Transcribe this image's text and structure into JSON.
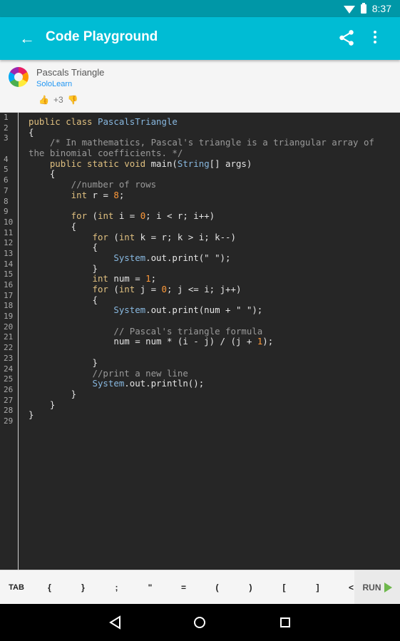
{
  "status": {
    "time": "8:37"
  },
  "app_bar": {
    "title": "Code Playground"
  },
  "code_info": {
    "title": "Pascals Triangle",
    "author": "SoloLearn",
    "votes": "+3"
  },
  "line_numbers": [
    "1",
    "2",
    "3",
    "",
    "4",
    "5",
    "6",
    "7",
    "8",
    "9",
    "10",
    "11",
    "12",
    "13",
    "14",
    "15",
    "16",
    "17",
    "18",
    "19",
    "20",
    "21",
    "22",
    "23",
    "24",
    "25",
    "26",
    "27",
    "28",
    "29"
  ],
  "code_lines": [
    [
      [
        "kw",
        "public class "
      ],
      [
        "ty",
        "PascalsTriangle"
      ]
    ],
    [
      [
        "",
        "{"
      ]
    ],
    [
      [
        "cm",
        "    /* In mathematics, Pascal's triangle is a triangular array of"
      ]
    ],
    [
      [
        "cm",
        "the binomial coefficients. */"
      ]
    ],
    [
      [
        "kw",
        "    public static void "
      ],
      [
        "",
        "main("
      ],
      [
        "ty",
        "String"
      ],
      [
        "",
        "[] args)"
      ]
    ],
    [
      [
        "",
        "    {"
      ]
    ],
    [
      [
        "cm",
        "        //number of rows"
      ]
    ],
    [
      [
        "kw",
        "        int "
      ],
      [
        "",
        "r = "
      ],
      [
        "num",
        "8"
      ],
      [
        "",
        ";"
      ]
    ],
    [
      [
        "",
        ""
      ]
    ],
    [
      [
        "kw",
        "        for "
      ],
      [
        "",
        "("
      ],
      [
        "kw",
        "int "
      ],
      [
        "",
        "i = "
      ],
      [
        "num",
        "0"
      ],
      [
        "",
        "; i < r; i++)"
      ]
    ],
    [
      [
        "",
        "        {"
      ]
    ],
    [
      [
        "kw",
        "            for "
      ],
      [
        "",
        "("
      ],
      [
        "kw",
        "int "
      ],
      [
        "",
        "k = r; k > i; k--)"
      ]
    ],
    [
      [
        "",
        "            {"
      ]
    ],
    [
      [
        "ty",
        "                System"
      ],
      [
        "",
        ".out.print(\" \");"
      ]
    ],
    [
      [
        "",
        "            }"
      ]
    ],
    [
      [
        "kw",
        "            int "
      ],
      [
        "",
        "num = "
      ],
      [
        "num",
        "1"
      ],
      [
        "",
        ";"
      ]
    ],
    [
      [
        "kw",
        "            for "
      ],
      [
        "",
        "("
      ],
      [
        "kw",
        "int "
      ],
      [
        "",
        "j = "
      ],
      [
        "num",
        "0"
      ],
      [
        "",
        "; j <= i; j++)"
      ]
    ],
    [
      [
        "",
        "            {"
      ]
    ],
    [
      [
        "ty",
        "                System"
      ],
      [
        "",
        ".out.print(num + \" \");"
      ]
    ],
    [
      [
        "",
        ""
      ]
    ],
    [
      [
        "cm",
        "                // Pascal's triangle formula"
      ]
    ],
    [
      [
        "",
        "                num = num * (i - j) / (j + "
      ],
      [
        "num",
        "1"
      ],
      [
        "",
        ");"
      ]
    ],
    [
      [
        "",
        ""
      ]
    ],
    [
      [
        "",
        "            }"
      ]
    ],
    [
      [
        "cm",
        "            //print a new line"
      ]
    ],
    [
      [
        "ty",
        "            System"
      ],
      [
        "",
        ".out.println();"
      ]
    ],
    [
      [
        "",
        "        }"
      ]
    ],
    [
      [
        "",
        "    }"
      ]
    ],
    [
      [
        "",
        "}"
      ]
    ],
    [
      [
        "",
        ""
      ]
    ]
  ],
  "keys": [
    "TAB",
    "{",
    "}",
    ";",
    "\"",
    "=",
    "(",
    ")",
    "[",
    "]",
    "<"
  ],
  "run_label": "RUN",
  "colors": {
    "accent": "#00bcd4",
    "status": "#0097a7",
    "editor_bg": "#262626",
    "run": "#6fb84d"
  },
  "icons": {
    "back": "arrow-back-icon",
    "share": "share-icon",
    "more": "more-vert-icon"
  }
}
